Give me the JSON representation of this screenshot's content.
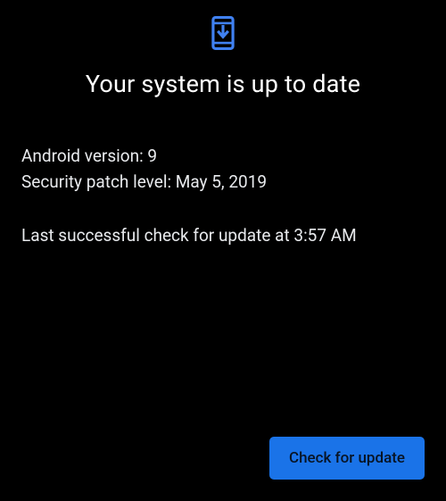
{
  "header": {
    "title": "Your system is up to date"
  },
  "info": {
    "android_version_label": "Android version: ",
    "android_version_value": "9",
    "security_patch_label": "Security patch level: ",
    "security_patch_value": "May 5, 2019",
    "last_check_prefix": "Last successful check for update at ",
    "last_check_time": "3:57 AM"
  },
  "button": {
    "check_label": "Check for update"
  },
  "colors": {
    "accent": "#1a73e8",
    "icon": "#4081f1"
  }
}
